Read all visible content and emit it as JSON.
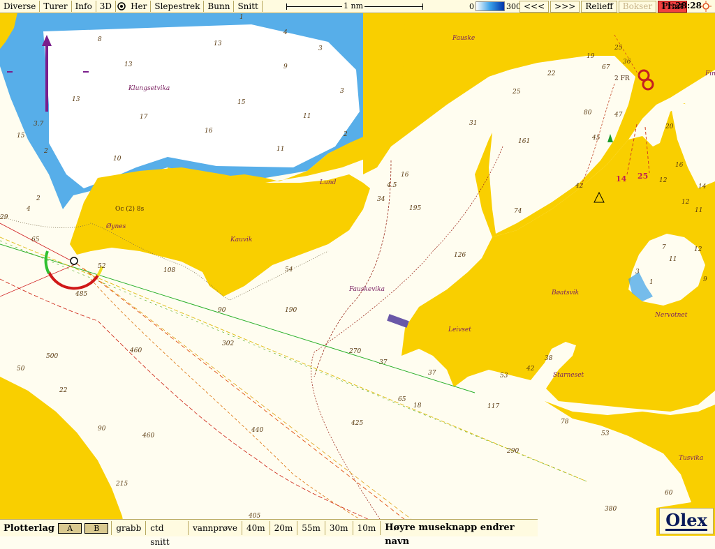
{
  "toolbar": {
    "menus": [
      "Diverse",
      "Turer",
      "Info",
      "3D"
    ],
    "her_label": "Her",
    "menus2": [
      "Slepestrek",
      "Bunn",
      "Snitt"
    ],
    "scale_label": "1 nm",
    "depth_min": "0",
    "depth_max": "300",
    "prev_label": "<<<",
    "next_label": ">>>",
    "relief_label": "Relieff",
    "bokser_label": "Bokser",
    "print_label": "Print",
    "time": "11:28:28"
  },
  "bottombar": {
    "plotterlag_label": "Plotterlag",
    "layer_a": "A",
    "layer_b": "B",
    "items": [
      "grabb",
      "ctd snitt",
      "vannprøve",
      "40m",
      "20m",
      "55m",
      "30m",
      "10m"
    ],
    "hint": "Høyre museknapp endrer navn"
  },
  "logo": "Olex",
  "colors": {
    "land": "#f9cf00",
    "water": "#fffdf0",
    "shallow": "#1e78d2",
    "marker": "#c42020",
    "arrow": "#7a1e8c"
  },
  "places": [
    {
      "name": "Fauske"
    },
    {
      "name": "Klungsetvika"
    },
    {
      "name": "Lund"
    },
    {
      "name": "Øynes"
    },
    {
      "name": "Kauvik"
    },
    {
      "name": "Fauskevika"
    },
    {
      "name": "Leivset"
    },
    {
      "name": "Bøatsvik"
    },
    {
      "name": "Nervotnet"
    },
    {
      "name": "Starneset"
    },
    {
      "name": "Tusvika"
    },
    {
      "name": "Fin"
    }
  ],
  "light_label": "Oc (2) 8s",
  "light_label2": "2 FR",
  "marks": [
    "14",
    "25"
  ],
  "soundings": [
    "1",
    "8",
    "4",
    "13",
    "3",
    "13",
    "9",
    "3",
    "13",
    "15",
    "17",
    "16",
    "11",
    "2",
    "3.7",
    "15",
    "2",
    "10",
    "11",
    "2",
    "4",
    "29",
    "65",
    "52",
    "108",
    "485",
    "54",
    "90",
    "190",
    "302",
    "460",
    "500",
    "50",
    "22",
    "90",
    "460",
    "215",
    "405",
    "4.5",
    "16",
    "34",
    "195",
    "31",
    "25",
    "161",
    "126",
    "74",
    "270",
    "37",
    "37",
    "65",
    "18",
    "425",
    "440",
    "290",
    "117",
    "53",
    "42",
    "38",
    "78",
    "53",
    "380",
    "60",
    "20",
    "16",
    "14",
    "12",
    "12",
    "11",
    "12",
    "7",
    "11",
    "9",
    "3",
    "1",
    "19",
    "25",
    "36",
    "67",
    "22",
    "80",
    "47",
    "45",
    "42"
  ]
}
